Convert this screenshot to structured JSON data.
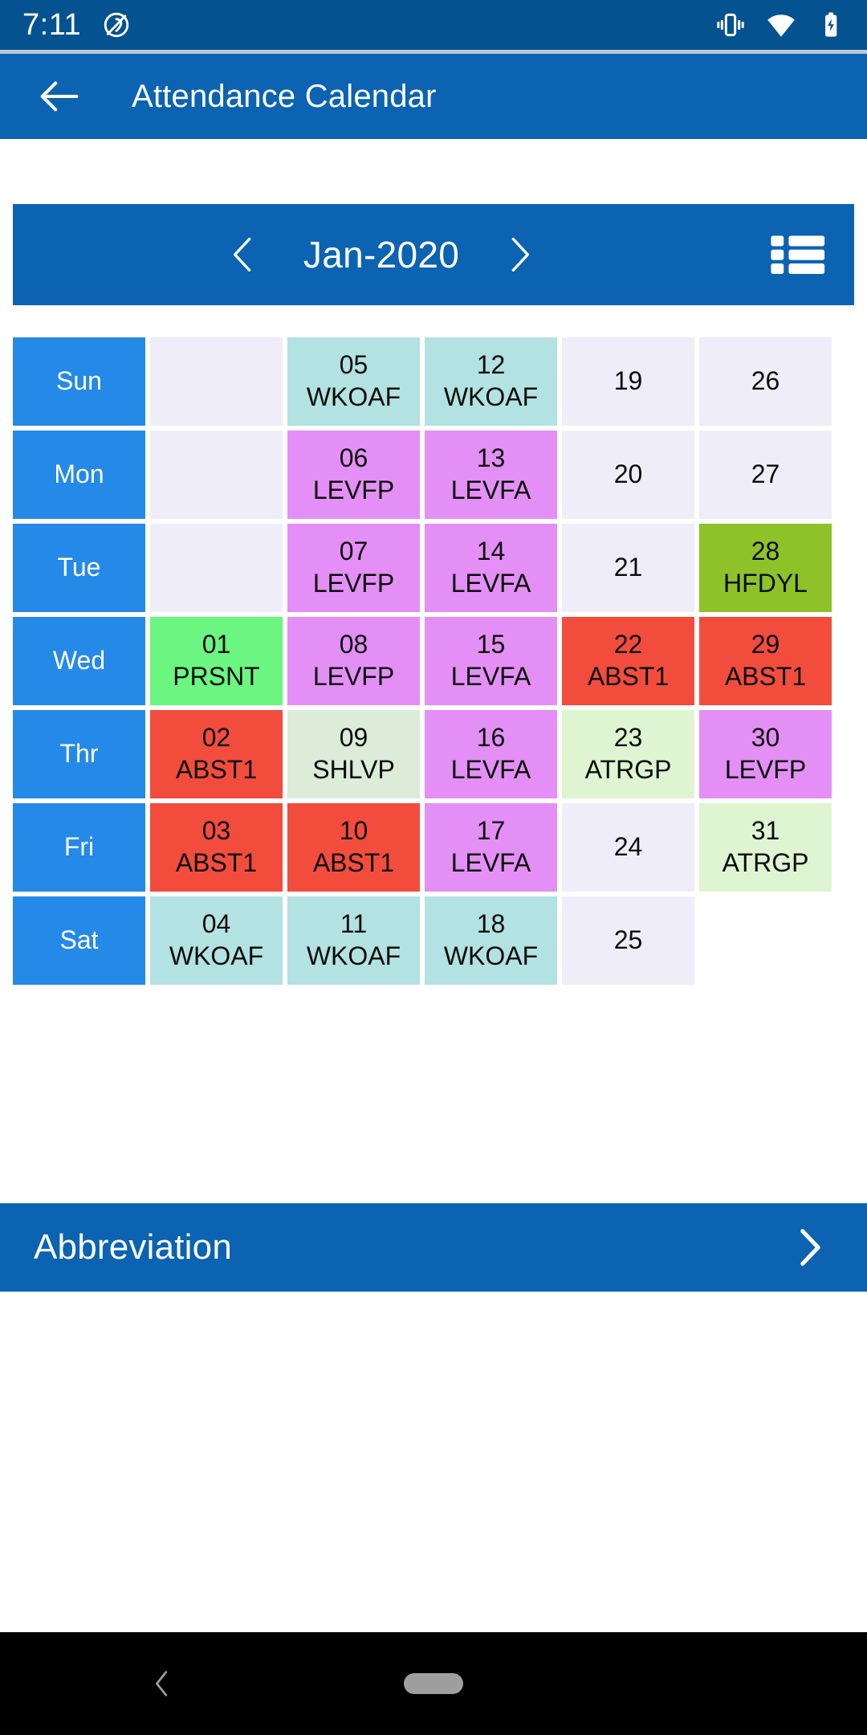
{
  "status_bar": {
    "time": "7:11",
    "icons_left": [
      "location-off-icon"
    ],
    "icons_right": [
      "vibrate-icon",
      "wifi-icon",
      "battery-charging-icon"
    ],
    "background": "#04528F"
  },
  "app_bar": {
    "back_icon": "arrow-left-icon",
    "title": "Attendance Calendar",
    "background": "#0B63B2"
  },
  "month_bar": {
    "prev_icon": "chevron-left-icon",
    "month_label": "Jan-2020",
    "next_icon": "chevron-right-icon",
    "list_view_icon": "list-view-icon",
    "background": "#0B63B2"
  },
  "calendar": {
    "day_labels": [
      "Sun",
      "Mon",
      "Tue",
      "Wed",
      "Thr",
      "Fri",
      "Sat"
    ],
    "day_label_bg": "#2589E8",
    "empty_cell_bg": "#EFEDF7",
    "status_colors": {
      "WKOAF": "#B2E2E2",
      "LEVFP": "#E38FF5",
      "LEVFA": "#E38FF5",
      "PRSNT": "#6BF581",
      "ABST1": "#F24C3D",
      "HFDYL": "#8DC328",
      "SHLVP": "#DDEBD9",
      "ATRGP": "#DFF5D2"
    },
    "rows": [
      {
        "day": "Sun",
        "cells": [
          {
            "date": "",
            "code": "",
            "status": "empty"
          },
          {
            "date": "05",
            "code": "WKOAF",
            "status": "WKOAF"
          },
          {
            "date": "12",
            "code": "WKOAF",
            "status": "WKOAF"
          },
          {
            "date": "19",
            "code": "",
            "status": "empty"
          },
          {
            "date": "26",
            "code": "",
            "status": "empty"
          }
        ]
      },
      {
        "day": "Mon",
        "cells": [
          {
            "date": "",
            "code": "",
            "status": "empty"
          },
          {
            "date": "06",
            "code": "LEVFP",
            "status": "LEVFP"
          },
          {
            "date": "13",
            "code": "LEVFA",
            "status": "LEVFA"
          },
          {
            "date": "20",
            "code": "",
            "status": "empty"
          },
          {
            "date": "27",
            "code": "",
            "status": "empty"
          }
        ]
      },
      {
        "day": "Tue",
        "cells": [
          {
            "date": "",
            "code": "",
            "status": "empty"
          },
          {
            "date": "07",
            "code": "LEVFP",
            "status": "LEVFP"
          },
          {
            "date": "14",
            "code": "LEVFA",
            "status": "LEVFA"
          },
          {
            "date": "21",
            "code": "",
            "status": "empty"
          },
          {
            "date": "28",
            "code": "HFDYL",
            "status": "HFDYL"
          }
        ]
      },
      {
        "day": "Wed",
        "cells": [
          {
            "date": "01",
            "code": "PRSNT",
            "status": "PRSNT"
          },
          {
            "date": "08",
            "code": "LEVFP",
            "status": "LEVFP"
          },
          {
            "date": "15",
            "code": "LEVFA",
            "status": "LEVFA"
          },
          {
            "date": "22",
            "code": "ABST1",
            "status": "ABST1"
          },
          {
            "date": "29",
            "code": "ABST1",
            "status": "ABST1"
          }
        ]
      },
      {
        "day": "Thr",
        "cells": [
          {
            "date": "02",
            "code": "ABST1",
            "status": "ABST1"
          },
          {
            "date": "09",
            "code": "SHLVP",
            "status": "SHLVP"
          },
          {
            "date": "16",
            "code": "LEVFA",
            "status": "LEVFA"
          },
          {
            "date": "23",
            "code": "ATRGP",
            "status": "ATRGP"
          },
          {
            "date": "30",
            "code": "LEVFP",
            "status": "LEVFP"
          }
        ]
      },
      {
        "day": "Fri",
        "cells": [
          {
            "date": "03",
            "code": "ABST1",
            "status": "ABST1"
          },
          {
            "date": "10",
            "code": "ABST1",
            "status": "ABST1"
          },
          {
            "date": "17",
            "code": "LEVFA",
            "status": "LEVFA"
          },
          {
            "date": "24",
            "code": "",
            "status": "empty"
          },
          {
            "date": "31",
            "code": "ATRGP",
            "status": "ATRGP"
          }
        ]
      },
      {
        "day": "Sat",
        "cells": [
          {
            "date": "04",
            "code": "WKOAF",
            "status": "WKOAF"
          },
          {
            "date": "11",
            "code": "WKOAF",
            "status": "WKOAF"
          },
          {
            "date": "18",
            "code": "WKOAF",
            "status": "WKOAF"
          },
          {
            "date": "25",
            "code": "",
            "status": "empty"
          },
          {
            "date": "",
            "code": "",
            "status": "blank"
          }
        ]
      }
    ]
  },
  "abbreviation_bar": {
    "label": "Abbreviation",
    "chevron_icon": "chevron-right-icon",
    "background": "#0B63B2"
  },
  "navigation_bar": {
    "back_icon": "chevron-left-icon",
    "home_pill": "home-gesture-pill",
    "background": "#000000"
  }
}
